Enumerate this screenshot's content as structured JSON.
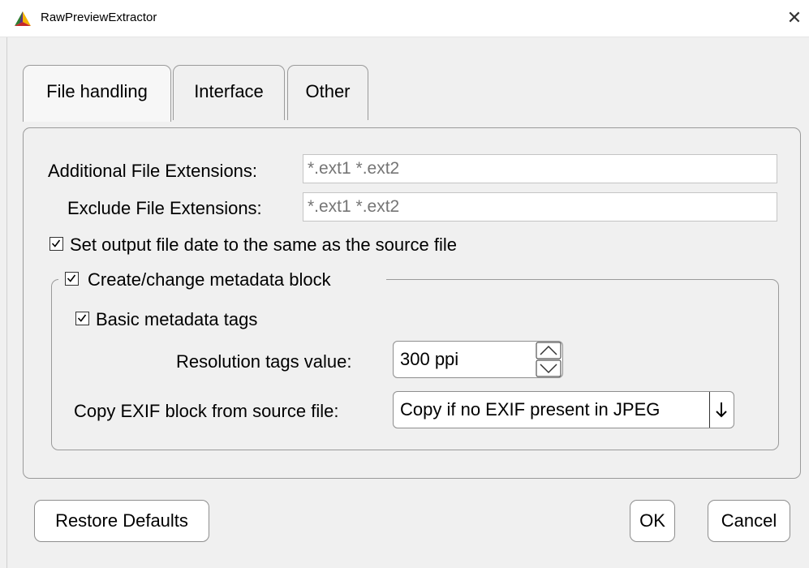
{
  "window": {
    "title": "RawPreviewExtractor",
    "icon": "app-logo-icon",
    "close_icon": "close-icon"
  },
  "tabs": [
    {
      "label": "File handling",
      "active": true
    },
    {
      "label": "Interface",
      "active": false
    },
    {
      "label": "Other",
      "active": false
    }
  ],
  "file_handling": {
    "additional_ext_label": "Additional File Extensions:",
    "additional_ext_placeholder": "*.ext1 *.ext2",
    "exclude_ext_label": "Exclude File Extensions:",
    "exclude_ext_placeholder": "*.ext1 *.ext2",
    "set_date_label": "Set output file date to the same as the source file",
    "set_date_checked": true,
    "metadata_group": {
      "label": "Create/change metadata block",
      "checked": true,
      "basic_tags_label": "Basic metadata tags",
      "basic_tags_checked": true,
      "resolution_label": "Resolution tags value:",
      "resolution_value": "300 ppi",
      "copy_exif_label": "Copy EXIF block from source file:",
      "copy_exif_value": "Copy if no EXIF present in JPEG"
    }
  },
  "buttons": {
    "restore_defaults": "Restore Defaults",
    "ok": "OK",
    "cancel": "Cancel"
  },
  "colors": {
    "window_bg": "#f0f0f0",
    "border": "#9a9a9a",
    "placeholder": "#8c8c8c"
  }
}
